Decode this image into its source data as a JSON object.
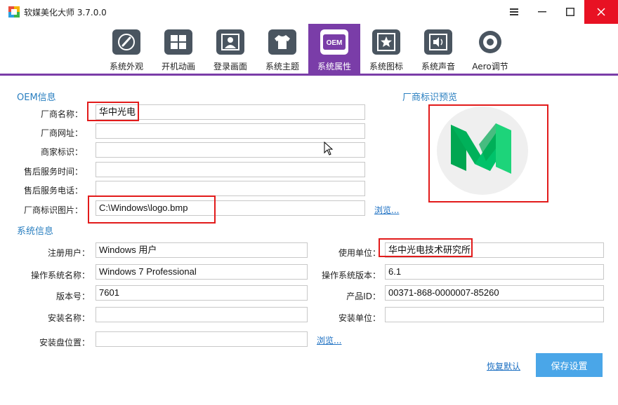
{
  "window": {
    "title": "软媒美化大师 3.7.0.0",
    "menu_icon": "hamburger-icon",
    "min_icon": "minimize-icon",
    "max_icon": "maximize-icon",
    "close_icon": "close-icon"
  },
  "tabs": [
    {
      "label": "系统外观",
      "icon": "brush-icon"
    },
    {
      "label": "开机动画",
      "icon": "windows-logo-icon"
    },
    {
      "label": "登录画面",
      "icon": "user-icon"
    },
    {
      "label": "系统主题",
      "icon": "tshirt-icon"
    },
    {
      "label": "系统属性",
      "icon": "oem-icon",
      "icon_text": "OEM",
      "active": true
    },
    {
      "label": "系统图标",
      "icon": "star-icon"
    },
    {
      "label": "系统声音",
      "icon": "speaker-icon"
    },
    {
      "label": "Aero调节",
      "icon": "aero-ring-icon"
    }
  ],
  "oem": {
    "section_title": "OEM信息",
    "fields": [
      {
        "label": "厂商名称：",
        "value": "华中光电"
      },
      {
        "label": "厂商网址：",
        "value": ""
      },
      {
        "label": "商家标识：",
        "value": ""
      },
      {
        "label": "售后服务时间：",
        "value": ""
      },
      {
        "label": "售后服务电话：",
        "value": ""
      },
      {
        "label": "厂商标识图片：",
        "value": "C:\\Windows\\logo.bmp"
      }
    ],
    "browse_label": "浏览..."
  },
  "preview": {
    "title": "厂商标识预览",
    "logo": "medium-m-logo"
  },
  "system": {
    "section_title": "系统信息",
    "left_fields": [
      {
        "label": "注册用户：",
        "value": "Windows 用户"
      },
      {
        "label": "操作系统名称：",
        "value": "Windows 7 Professional"
      },
      {
        "label": "版本号：",
        "value": "7601"
      },
      {
        "label": "安装名称：",
        "value": ""
      },
      {
        "label": "安装盘位置：",
        "value": ""
      }
    ],
    "right_fields": [
      {
        "label": "使用单位：",
        "value": "华中光电技术研究所"
      },
      {
        "label": "操作系统版本：",
        "value": "6.1"
      },
      {
        "label": "产品ID：",
        "value": "00371-868-0000007-85260"
      },
      {
        "label": "安装单位：",
        "value": ""
      }
    ],
    "browse_label": "浏览..."
  },
  "actions": {
    "restore_label": "恢复默认",
    "save_label": "保存设置"
  },
  "colors": {
    "accent": "#7a3da8",
    "section_title": "#2a7fc0",
    "save_button": "#4aa6e8",
    "close_button": "#e81123",
    "highlight_box": "#e21b1b",
    "logo_green_dark": "#00a651",
    "logo_green_light": "#1dd47a"
  }
}
